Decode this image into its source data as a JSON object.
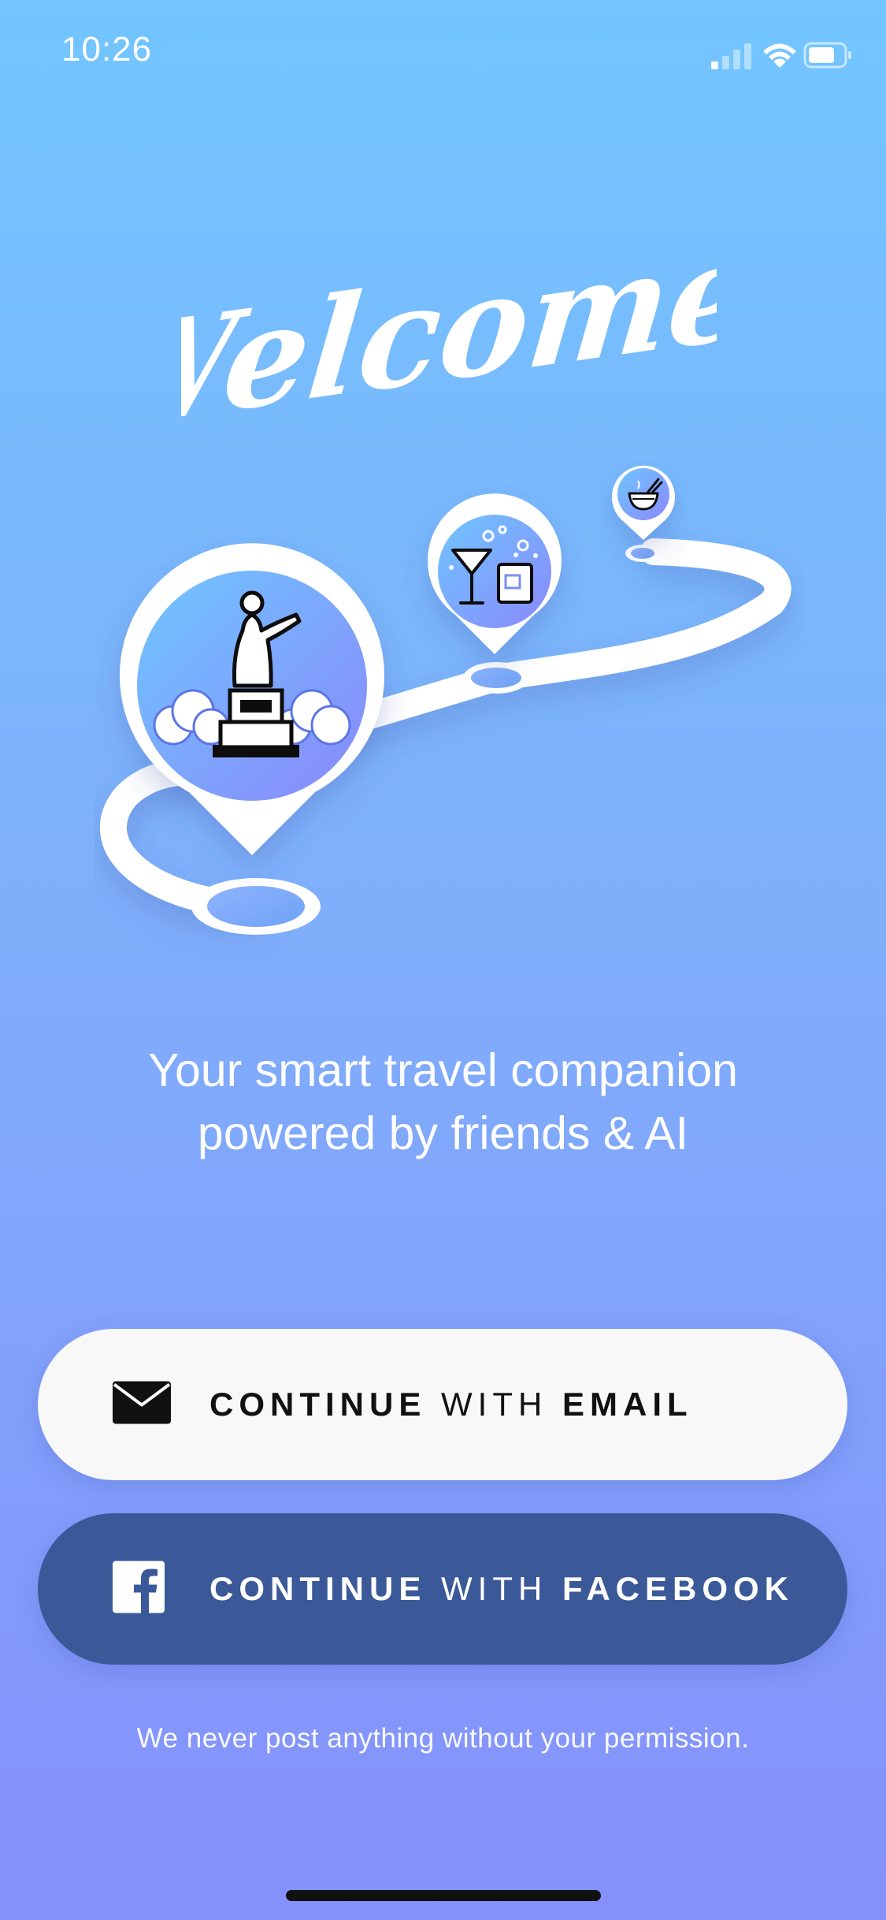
{
  "status_bar": {
    "time": "10:26",
    "icons": [
      "cellular-signal-icon",
      "wifi-icon",
      "battery-icon"
    ]
  },
  "welcome": {
    "title": "Welcome"
  },
  "illustration": {
    "pins": [
      "statue-icon",
      "cocktail-icon",
      "food-bowl-icon"
    ]
  },
  "tagline": {
    "line1": "Your smart travel companion",
    "line2": "powered by friends & AI"
  },
  "buttons": {
    "email": {
      "part1": "CONTINUE",
      "part2": "WITH",
      "part3": "EMAIL",
      "icon": "envelope-icon"
    },
    "facebook": {
      "part1": "CONTINUE",
      "part2": "WITH",
      "part3": "FACEBOOK",
      "icon": "facebook-icon"
    }
  },
  "disclaimer": "We never post anything without your permission.",
  "colors": {
    "bg_top": "#72c5ff",
    "bg_bottom": "#8590fb",
    "email_button": "#f8f8f8",
    "facebook_button": "#3b5998"
  }
}
